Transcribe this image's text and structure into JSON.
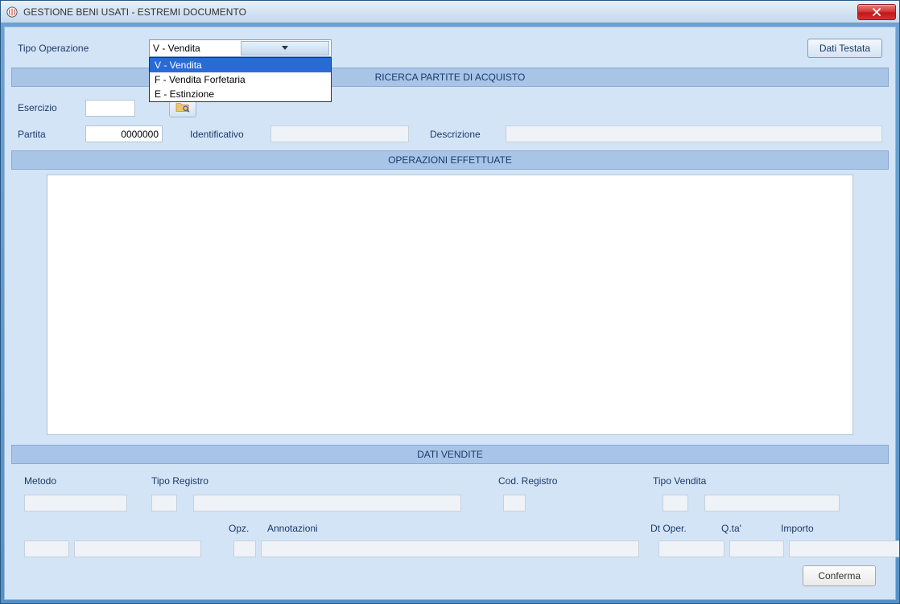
{
  "window": {
    "title": "GESTIONE BENI USATI - ESTREMI DOCUMENTO"
  },
  "top": {
    "tipo_operazione_label": "Tipo Operazione",
    "tipo_operazione_value": "V - Vendita",
    "tipo_operazione_input": "V - Vendita",
    "options": [
      "V - Vendita",
      "F - Vendita Forfetaria",
      "E - Estinzione"
    ],
    "dati_testata": "Dati Testata"
  },
  "ricerca": {
    "header": "RICERCA PARTITE DI ACQUISTO",
    "esercizio_label": "Esercizio",
    "esercizio_value": "",
    "partita_label": "Partita",
    "partita_value": "0000000",
    "identificativo_label": "Identificativo",
    "identificativo_value": "",
    "descrizione_label": "Descrizione",
    "descrizione_value": ""
  },
  "operazioni": {
    "header": "OPERAZIONI EFFETTUATE"
  },
  "vendite": {
    "header": "DATI VENDITE",
    "metodo_label": "Metodo",
    "tipo_registro_label": "Tipo Registro",
    "cod_registro_label": "Cod. Registro",
    "tipo_vendita_label": "Tipo Vendita",
    "opz_label": "Opz.",
    "annotazioni_label": "Annotazioni",
    "dt_oper_label": "Dt Oper.",
    "qta_label": "Q.ta'",
    "importo_label": "Importo",
    "conferma": "Conferma"
  }
}
